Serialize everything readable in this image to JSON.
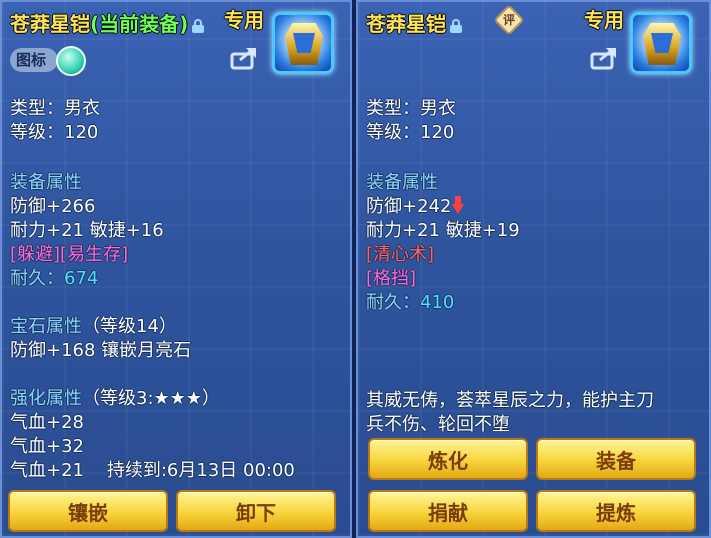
{
  "left_panel": {
    "title": "苍莽星铠",
    "title_status": "(当前装备)",
    "exclusive_label": "专用",
    "icon_toggle_label": "图标",
    "lines": {
      "type": "类型：男衣",
      "level": "等级：120",
      "equip_attr_heading": "装备属性",
      "defense": "防御+266",
      "stats": "耐力+21 敏捷+16",
      "special": "[躲避][易生存]",
      "durability_label": "耐久：",
      "durability_value": "674",
      "gem_heading": "宝石属性",
      "gem_level": "（等级14）",
      "gem_bonus": "防御+168 镶嵌月亮石",
      "enhance_heading": "强化属性",
      "enhance_level": "（等级3:★★★）",
      "hp1": "气血+28",
      "hp2": "气血+32",
      "hp3": "气血+21    持续到:6月13日 00:00"
    },
    "buttons": {
      "inlay": "镶嵌",
      "unequip": "卸下"
    }
  },
  "right_panel": {
    "title": "苍莽星铠",
    "rating_badge": "评",
    "exclusive_label": "专用",
    "lines": {
      "type": "类型：男衣",
      "level": "等级：120",
      "equip_attr_heading": "装备属性",
      "defense": "防御+242",
      "stats": "耐力+21 敏捷+19",
      "special1": "[清心术]",
      "special2": "[格挡]",
      "durability_label": "耐久：",
      "durability_value": "410",
      "description_1": "其威无俦，荟萃星辰之力，能护主刀",
      "description_2": "兵不伤、轮回不堕"
    },
    "buttons": {
      "refine": "炼化",
      "equip": "装备",
      "donate": "捐献",
      "extract": "提炼"
    }
  },
  "colors": {
    "title": "#ffe45a",
    "current_equipped": "#6cff58",
    "heading": "#8ad7ff",
    "special_pink": "#ff6ad8",
    "special_red": "#ff6464",
    "durability": "#4fe3ff",
    "button": "#f7d43a",
    "panel": "#2f559f"
  },
  "icons": [
    "lock-icon",
    "armor-icon",
    "share-icon",
    "toggle-knob-icon",
    "down-arrow-icon",
    "rating-badge-icon"
  ]
}
